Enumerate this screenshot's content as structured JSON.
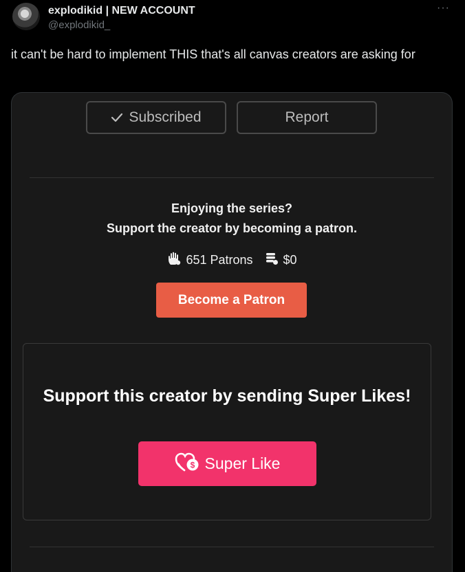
{
  "tweet": {
    "author_name": "explodikid | NEW ACCOUNT",
    "author_handle": "@explodikid_",
    "more_icon": "···",
    "text": "it can't be hard to implement THIS that's all canvas creators are asking for"
  },
  "media": {
    "subscribed_label": "Subscribed",
    "report_label": "Report",
    "support_line1": "Enjoying the series?",
    "support_line2": "Support the creator by becoming a patron.",
    "patrons_count": "651 Patrons",
    "amount": "$0",
    "become_patron_label": "Become a Patron",
    "superlike_heading": "Support this creator by sending Super Likes!",
    "superlike_label": "Super Like",
    "colors": {
      "patron_button": "#e85d45",
      "superlike_button": "#f2336b",
      "card_background": "#191919"
    },
    "icons": [
      "check-icon",
      "hand-icon",
      "coins-icon",
      "heart-coin-icon"
    ]
  }
}
